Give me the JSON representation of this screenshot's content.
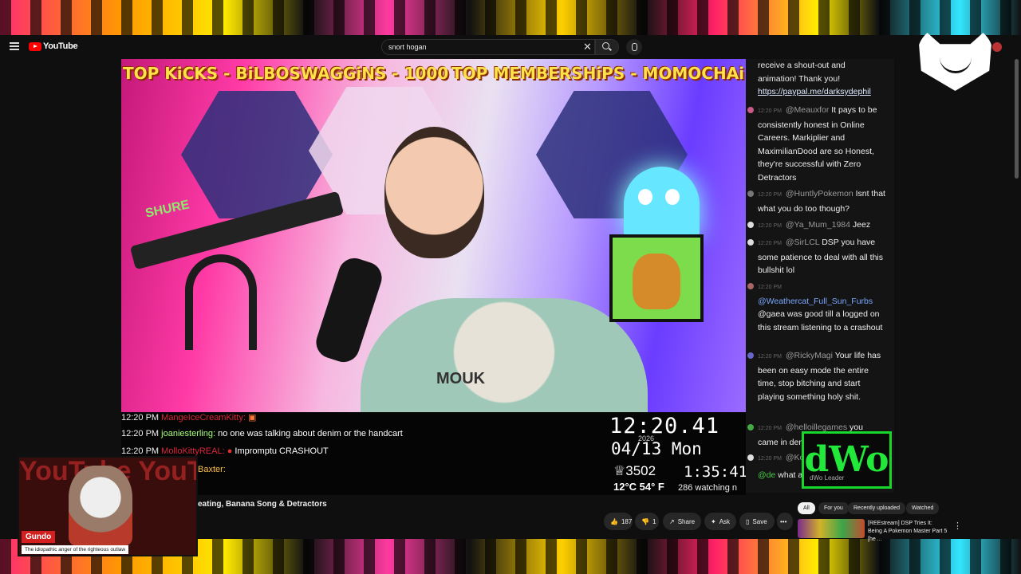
{
  "app": {
    "logo_text": "YouTube"
  },
  "search": {
    "value": "snort hogan"
  },
  "video": {
    "banner_left": "TOP KiCKS -  BiLBOSWAGGiNS - 1000",
    "banner_right": "TOP MEMBERSHiPS - MOMOCHAi",
    "mic_brand": "SHURE",
    "shirt_text": "MOUK"
  },
  "overlay_chat": [
    {
      "time": "12:20 PM",
      "user": "MangeIceCreamKitty:",
      "text": ""
    },
    {
      "time": "12:20 PM",
      "user": "joaniesterling:",
      "text": "no one was talking about denim or the handcart"
    },
    {
      "time": "12:20 PM",
      "user": "MolloKittyREAL:",
      "text": "Impromptu CRASHOUT"
    },
    {
      "time": "",
      "user": "Baxter:",
      "text": ""
    }
  ],
  "stats": {
    "clock": "12:20.41",
    "year": "2026",
    "date": "04/13 Mon",
    "viewers": "♕3502",
    "uptime": "1:35:41",
    "temp": "12°C 54° F",
    "watching": "286 watching n"
  },
  "chat": [
    {
      "time": "",
      "author": "",
      "text": "receive a shout-out and animation! Thank you!",
      "link": "https://paypal.me/darksydephil"
    },
    {
      "time": "12:20 PM",
      "author": "@Meauxfor",
      "text": "It pays to be consistently honest in Online Careers. Markiplier and MaximilianDood are so Honest, they're successful with Zero Detractors"
    },
    {
      "time": "12:20 PM",
      "author": "@HuntlyPokemon",
      "text": "Isnt that what you do too though?"
    },
    {
      "time": "12:20 PM",
      "author": "@Ya_Mum_1984",
      "text": "Jeez"
    },
    {
      "time": "12:20 PM",
      "author": "@SirLCL",
      "text": "DSP you have some patience to deal with all this bullshit lol"
    },
    {
      "time": "12:20 PM",
      "author": "@Weathercat_Full_Sun_Furbs",
      "text": "@gaea was good till a logged on this stream listening to a crashout"
    },
    {
      "time": "12:20 PM",
      "author": "@RickyMagi",
      "text": "Your life has been on easy mode the entire time, stop bitching and start playing something holy shit."
    },
    {
      "time": "12:20 PM",
      "author": "@helloillegames",
      "text": "you came in denim"
    },
    {
      "time": "12:20 PM",
      "author": "@Kop",
      "text": ""
    },
    {
      "time": "",
      "author": "@de",
      "text": "what about your pet bird?"
    }
  ],
  "dwo": {
    "logo": "dWo",
    "sub": "dWo Leader"
  },
  "bottom": {
    "title": "eating, Banana Song & Detractors",
    "like_count": "187",
    "dislike_count": "1",
    "share_label": "Share",
    "ask_label": "Ask",
    "save_label": "Save",
    "more_label": "•••",
    "chips": [
      "All",
      "For you",
      "Recently uploaded",
      "Watched"
    ],
    "rec_title": "[REEstream] DSP Tries It: Being A Pokemon Master Part 5 [he ..."
  },
  "gundo": {
    "bg_text": "YouTube YouTube",
    "name": "Gundo",
    "tagline": "The idiopathic anger of the righteous outlaw"
  },
  "colors": {
    "accent_red": "#ff0000",
    "dwo_green": "#19d62a",
    "banner_yellow": "#ffe14a"
  }
}
